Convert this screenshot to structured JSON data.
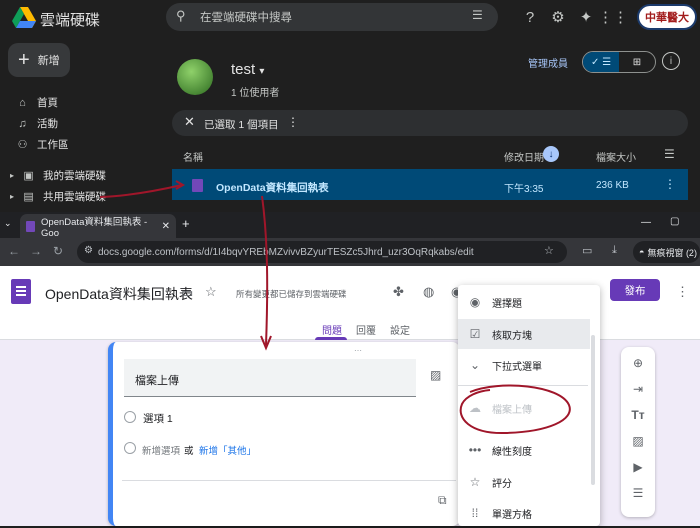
{
  "drive": {
    "app_title": "雲端硬碟",
    "search_placeholder": "在雲端硬碟中搜尋",
    "badge_text": "中華醫大",
    "new_label": "新增",
    "sidebar": [
      {
        "label": "首頁",
        "icon": "home-icon"
      },
      {
        "label": "活動",
        "icon": "bell-icon"
      },
      {
        "label": "工作區",
        "icon": "workspace-icon"
      },
      {
        "label": "我的雲端硬碟",
        "icon": "my-drive-icon"
      },
      {
        "label": "共用雲端硬碟",
        "icon": "shared-drive-icon"
      }
    ],
    "folder": {
      "name": "test",
      "users": "1 位使用者"
    },
    "manage_members": "管理成員",
    "selection": {
      "text": "已選取 1 個項目"
    },
    "columns": {
      "name": "名稱",
      "modified": "修改日期",
      "size": "檔案大小"
    },
    "file": {
      "name": "OpenData資料集回執表",
      "date": "下午3:35",
      "size": "236 KB"
    }
  },
  "browser": {
    "tab_title": "OpenData資料集回執表 - Goo",
    "url": "docs.google.com/forms/d/1I4bqvYREbMZvivvBZyurTESZc5Jhrd_uzr3OqRqkabs/edit",
    "incognito": "無痕視窗 (2)"
  },
  "form": {
    "title": "OpenData資料集回執表",
    "saved": "所有變更都已儲存到雲端硬碟",
    "publish": "發布",
    "tabs": [
      "問題",
      "回覆",
      "設定"
    ],
    "question_title": "檔案上傳",
    "option1": "選項 1",
    "add_option": "新增選項",
    "or": "或",
    "add_other": "新增「其他」"
  },
  "menu": {
    "items": [
      {
        "label": "選擇題",
        "icon": "radio-icon"
      },
      {
        "label": "核取方塊",
        "icon": "checkbox-icon"
      },
      {
        "label": "下拉式選單",
        "icon": "dropdown-icon"
      },
      {
        "label": "檔案上傳",
        "icon": "upload-cloud-icon",
        "disabled": true
      },
      {
        "label": "線性刻度",
        "icon": "linear-scale-icon"
      },
      {
        "label": "評分",
        "icon": "star-icon"
      },
      {
        "label": "單選方格",
        "icon": "grid-icon"
      }
    ]
  },
  "colors": {
    "accent": "#673ab7",
    "drive_select": "#004a77",
    "annotation": "#a0162a"
  }
}
